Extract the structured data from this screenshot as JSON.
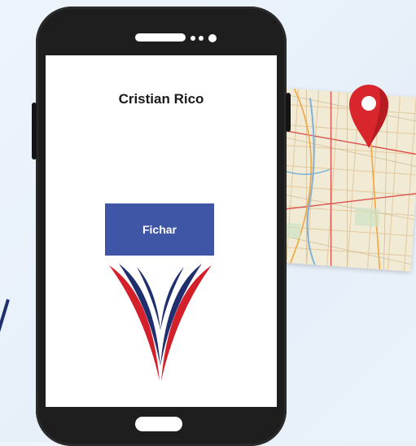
{
  "user": {
    "name": "Cristian Rico"
  },
  "actions": {
    "clock_in_label": "Fichar"
  },
  "colors": {
    "button": "#3f56a6",
    "logo_red": "#d4202a",
    "logo_blue": "#1f2f6e",
    "pin_red": "#d9262c",
    "phone_body": "#1e1e1e"
  },
  "icons": [
    "map-icon",
    "location-pin-icon",
    "brand-logo"
  ]
}
